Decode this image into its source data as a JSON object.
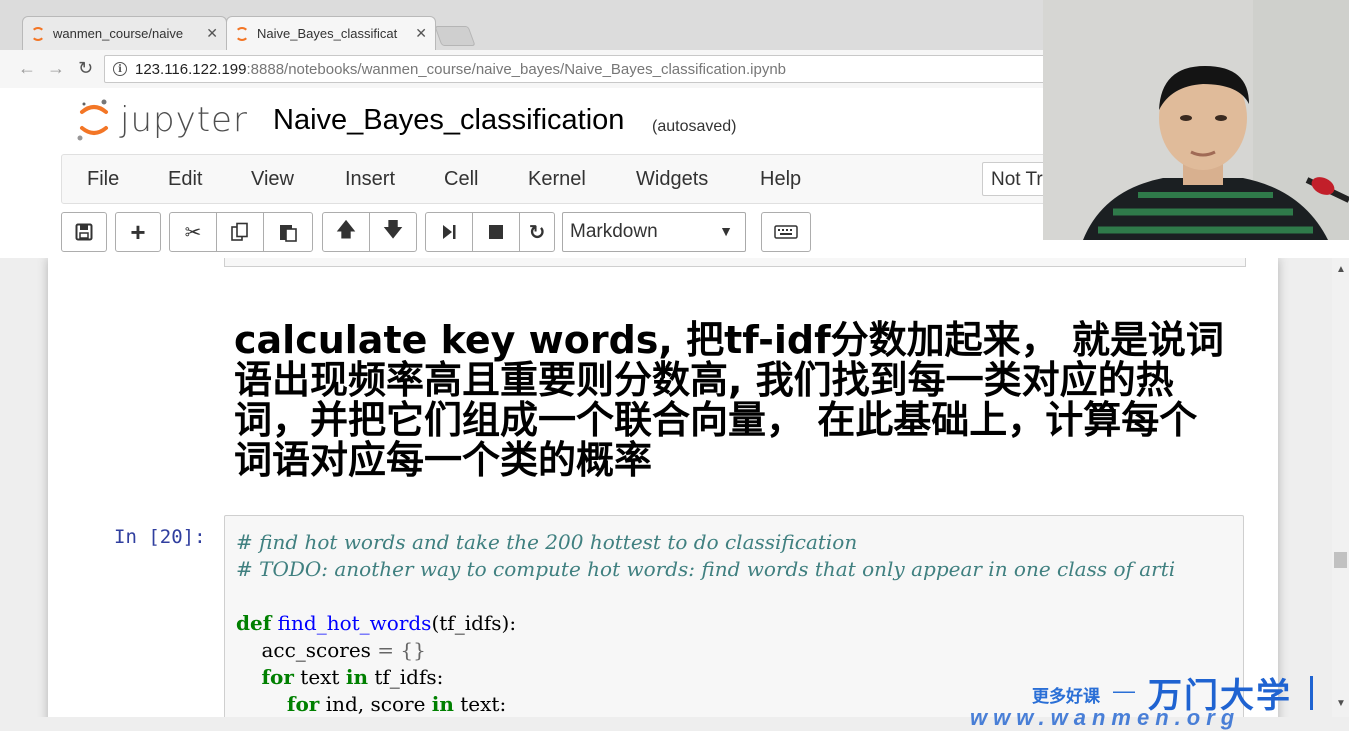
{
  "browser": {
    "tabs": [
      {
        "title": "wanmen_course/naive",
        "active": false
      },
      {
        "title": "Naive_Bayes_classificat",
        "active": true
      }
    ],
    "url_host": "123.116.122.199",
    "url_rest": ":8888/notebooks/wanmen_course/naive_bayes/Naive_Bayes_classification.ipynb"
  },
  "jupyter": {
    "logo_text": "jupyter",
    "notebook_title": "Naive_Bayes_classification",
    "autosave_status": "(autosaved)",
    "menu": [
      "File",
      "Edit",
      "View",
      "Insert",
      "Cell",
      "Kernel",
      "Widgets",
      "Help"
    ],
    "trust_status": "Not Trusted",
    "cell_type": "Markdown",
    "accent_color": "#f37626"
  },
  "cells": {
    "markdown_heading": "calculate key words, 把tf-idf分数加起来， 就是说词语出现频率高且重要则分数高, 我们找到每一类对应的热词，并把它们组成一个联合向量， 在此基础上，计算每个词语对应每一个类的概率",
    "code_prompt": "In  [20]:",
    "code": {
      "comment1": "# find hot words and take the 200 hottest to do classification",
      "comment2": "# TODO: another way to compute hot words: find words that only appear in one class of arti",
      "def_kw": "def",
      "fn_name": "find_hot_words",
      "fn_args": "(tf_idfs):",
      "line_acc_var": "acc_scores",
      "line_acc_op": "=",
      "line_acc_val": "{}",
      "for_kw": "for",
      "in_kw": "in",
      "loop1_var": "text",
      "loop1_iter": "tf_idfs:",
      "loop2_var": "ind, score",
      "loop2_iter": "text:"
    }
  },
  "watermark": {
    "more": "更多好课",
    "dash": "—",
    "brand": "万门大学",
    "site": "www.wanmen.org"
  }
}
